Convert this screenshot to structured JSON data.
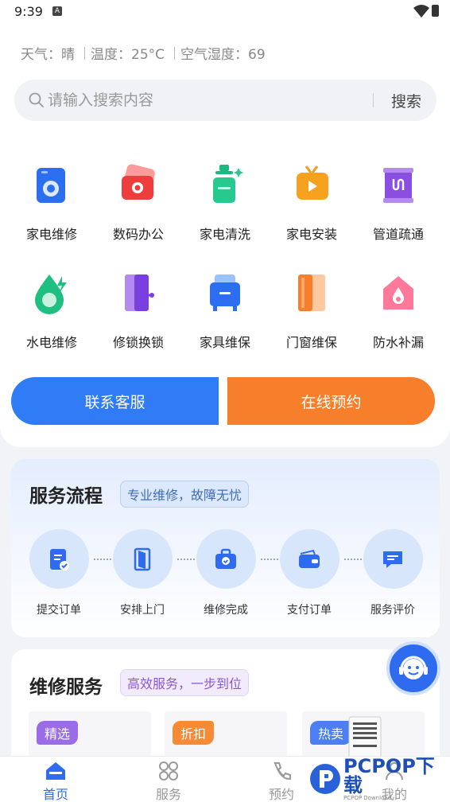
{
  "status": {
    "time": "9:39",
    "notif": "A"
  },
  "weather": {
    "weather_text": "天气：晴",
    "temp_text": "温度：25°C",
    "humidity_text": "空气湿度：69"
  },
  "search": {
    "placeholder": "请输入搜索内容",
    "button": "搜索"
  },
  "categories": [
    {
      "label": "家电维修",
      "icon": "washing-machine-icon"
    },
    {
      "label": "数码办公",
      "icon": "camera-icon"
    },
    {
      "label": "家电清洗",
      "icon": "cleaning-icon"
    },
    {
      "label": "家电安装",
      "icon": "tv-icon"
    },
    {
      "label": "管道疏通",
      "icon": "pipe-icon"
    },
    {
      "label": "水电维修",
      "icon": "water-drop-icon"
    },
    {
      "label": "修锁换锁",
      "icon": "door-lock-icon"
    },
    {
      "label": "家具维保",
      "icon": "cabinet-icon"
    },
    {
      "label": "门窗维保",
      "icon": "window-icon"
    },
    {
      "label": "防水补漏",
      "icon": "house-drop-icon"
    }
  ],
  "actions": {
    "contact": "联系客服",
    "book": "在线预约"
  },
  "process": {
    "title": "服务流程",
    "tag": "专业维修，故障无忧",
    "steps": [
      {
        "label": "提交订单",
        "icon": "document-check-icon"
      },
      {
        "label": "安排上门",
        "icon": "door-icon"
      },
      {
        "label": "维修完成",
        "icon": "toolbox-icon"
      },
      {
        "label": "支付订单",
        "icon": "wallet-icon"
      },
      {
        "label": "服务评价",
        "icon": "chat-icon"
      }
    ]
  },
  "repair": {
    "title": "维修服务",
    "tag": "高效服务，一步到位",
    "promos": [
      {
        "tag": "精选",
        "color": "#9a6ce8"
      },
      {
        "tag": "折扣",
        "color": "#f68a35"
      },
      {
        "tag": "热卖",
        "color": "#4b7ff2"
      }
    ]
  },
  "nav": [
    {
      "label": "首页",
      "icon": "home-icon"
    },
    {
      "label": "服务",
      "icon": "grid-icon"
    },
    {
      "label": "预约",
      "icon": "phone-icon"
    },
    {
      "label": "我的",
      "icon": "user-icon"
    }
  ],
  "watermark": {
    "text": "PCPOP下载",
    "sub": "PCPOP Download"
  },
  "colors": {
    "primary": "#2f7cf6",
    "accent": "#f77e2a"
  }
}
